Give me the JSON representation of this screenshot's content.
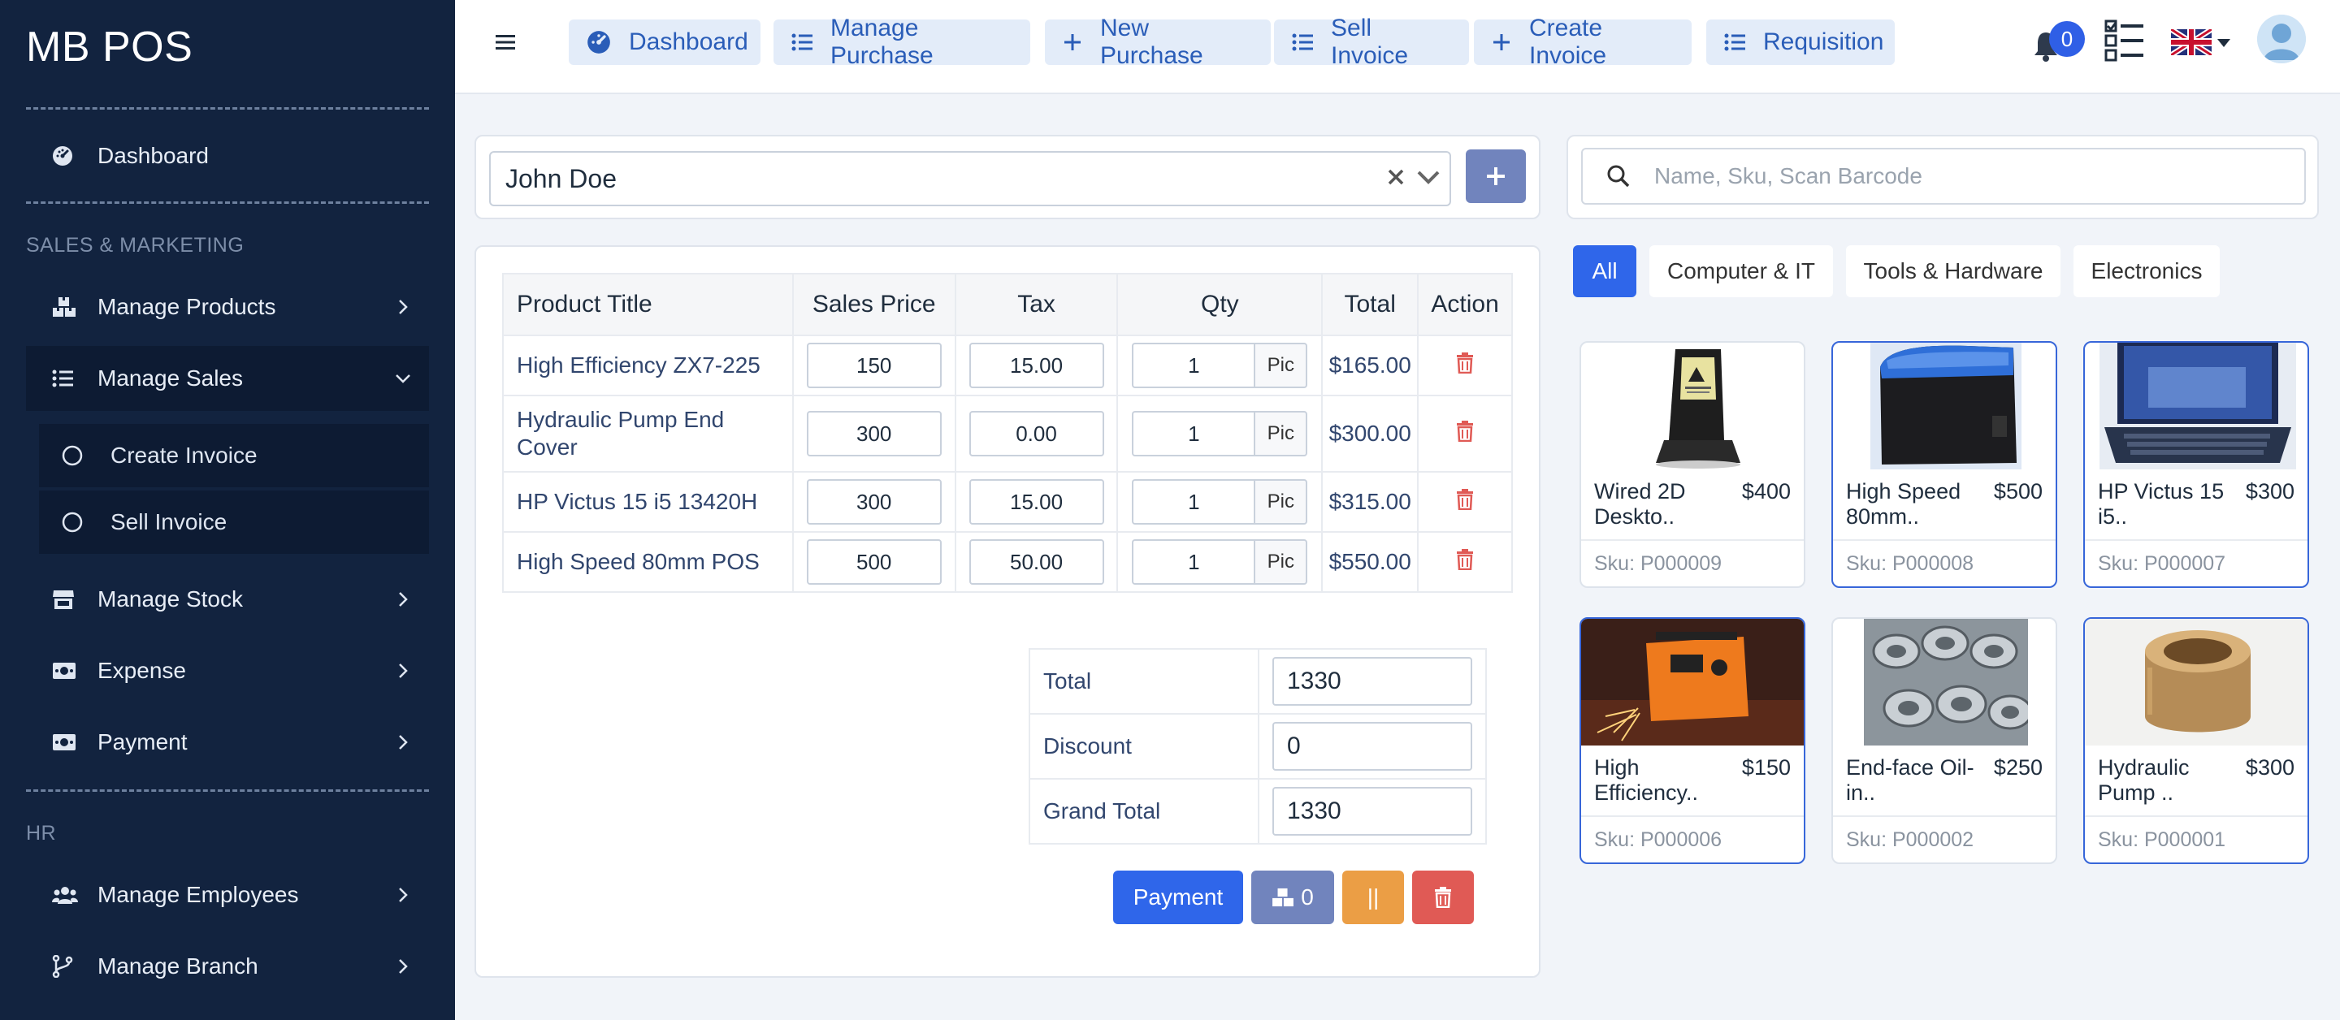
{
  "app": {
    "brand": "MB POS"
  },
  "sidebar": {
    "dashboard": "Dashboard",
    "section_sales": "SALES & MARKETING",
    "manage_products": "Manage Products",
    "manage_sales": "Manage Sales",
    "create_invoice": "Create Invoice",
    "sell_invoice": "Sell Invoice",
    "manage_stock": "Manage Stock",
    "expense": "Expense",
    "payment": "Payment",
    "section_hr": "HR",
    "manage_employees": "Manage Employees",
    "manage_branch": "Manage Branch"
  },
  "topnav": {
    "dashboard": "Dashboard",
    "manage_purchase": "Manage Purchase",
    "new_purchase": "New Purchase",
    "sell_invoice": "Sell Invoice",
    "create_invoice": "Create Invoice",
    "requisition": "Requisition",
    "notification_count": "0"
  },
  "customer": {
    "selected": "John Doe"
  },
  "search": {
    "placeholder": "Name, Sku, Scan Barcode"
  },
  "table": {
    "headers": {
      "title": "Product Title",
      "price": "Sales Price",
      "tax": "Tax",
      "qty": "Qty",
      "total": "Total",
      "action": "Action"
    },
    "rows": [
      {
        "title": "High Efficiency ZX7-225",
        "price": "150",
        "tax": "15.00",
        "qty": "1",
        "unit": "Pic",
        "total": "$165.00"
      },
      {
        "title": "Hydraulic Pump End Cover",
        "price": "300",
        "tax": "0.00",
        "qty": "1",
        "unit": "Pic",
        "total": "$300.00"
      },
      {
        "title": "HP Victus 15 i5 13420H",
        "price": "300",
        "tax": "15.00",
        "qty": "1",
        "unit": "Pic",
        "total": "$315.00"
      },
      {
        "title": "High Speed 80mm POS",
        "price": "500",
        "tax": "50.00",
        "qty": "1",
        "unit": "Pic",
        "total": "$550.00"
      }
    ]
  },
  "summary": {
    "total_label": "Total",
    "total": "1330",
    "discount_label": "Discount",
    "discount": "0",
    "grand_label": "Grand Total",
    "grand": "1330"
  },
  "actions": {
    "payment": "Payment",
    "hold_count": "0",
    "pause": "||"
  },
  "categories": [
    "All",
    "Computer & IT",
    "Tools & Hardware",
    "Electronics"
  ],
  "products": [
    {
      "name": "Wired 2D Deskto..",
      "price": "$400",
      "sku": "Sku: P000009"
    },
    {
      "name": "High Speed 80mm..",
      "price": "$500",
      "sku": "Sku: P000008"
    },
    {
      "name": "HP Victus 15 i5..",
      "price": "$300",
      "sku": "Sku: P000007"
    },
    {
      "name": "High Efficiency..",
      "price": "$150",
      "sku": "Sku: P000006"
    },
    {
      "name": "End-face Oil-in..",
      "price": "$250",
      "sku": "Sku: P000002"
    },
    {
      "name": "Hydraulic Pump ..",
      "price": "$300",
      "sku": "Sku: P000001"
    }
  ],
  "colors": {
    "sidebar": "#12233f",
    "accent": "#2f66ea",
    "nav_bg": "#e3ecf9",
    "danger": "#e05a55",
    "warning": "#eb9e45",
    "hold": "#7184bd"
  }
}
